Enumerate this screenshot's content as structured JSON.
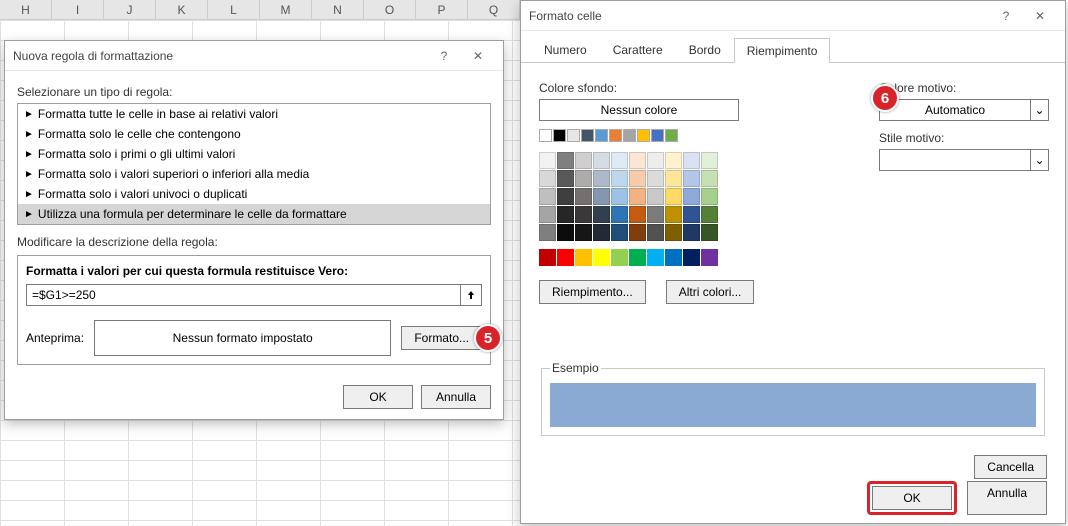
{
  "sheet": {
    "columns": [
      "H",
      "I",
      "J",
      "K",
      "L",
      "M",
      "N",
      "O",
      "P",
      "Q"
    ]
  },
  "dlg1": {
    "title": "Nuova regola di formattazione",
    "select_label": "Selezionare un tipo di regola:",
    "rules": [
      "Formatta tutte le celle in base ai relativi valori",
      "Formatta solo le celle che contengono",
      "Formatta solo i primi o gli ultimi valori",
      "Formatta solo i valori superiori o inferiori alla media",
      "Formatta solo i valori univoci o duplicati",
      "Utilizza una formula per determinare le celle da formattare"
    ],
    "selected_rule_index": 5,
    "edit_label": "Modificare la descrizione della regola:",
    "formula_header": "Formatta i valori per cui questa formula restituisce Vero:",
    "formula_value": "=$G1>=250",
    "preview_label": "Anteprima:",
    "preview_value": "Nessun formato impostato",
    "format_btn": "Formato...",
    "ok": "OK",
    "cancel": "Annulla"
  },
  "dlg2": {
    "title": "Formato celle",
    "tabs": [
      "Numero",
      "Carattere",
      "Bordo",
      "Riempimento"
    ],
    "active_tab_index": 3,
    "bg_label": "Colore sfondo:",
    "bg_value": "Nessun colore",
    "pattern_color_label": "Colore motivo:",
    "pattern_color_value": "Automatico",
    "pattern_style_label": "Stile motivo:",
    "pattern_style_value": "",
    "fill_effects_btn": "Riempimento...",
    "more_colors_btn": "Altri colori...",
    "example_label": "Esempio",
    "example_color": "#8aaad4",
    "clear_btn": "Cancella",
    "ok": "OK",
    "cancel": "Annulla",
    "simple_swatches": [
      "#ffffff",
      "#000000",
      "#e7e6e6",
      "#44546a",
      "#5b9bd5",
      "#ed7d31",
      "#a5a5a5",
      "#ffc000",
      "#4472c4",
      "#70ad47"
    ],
    "theme_swatches": [
      "#f2f2f2",
      "#7f7f7f",
      "#d0cece",
      "#d6dce4",
      "#deebf6",
      "#fbe5d5",
      "#ededed",
      "#fff2cc",
      "#d9e2f3",
      "#e2efd9",
      "#d8d8d8",
      "#595959",
      "#aeabab",
      "#adb9ca",
      "#bdd7ee",
      "#f7cbac",
      "#dbdbdb",
      "#fee599",
      "#b4c6e7",
      "#c5e0b3",
      "#bfbfbf",
      "#3f3f3f",
      "#757070",
      "#8496b0",
      "#9cc3e5",
      "#f4b183",
      "#c9c9c9",
      "#ffd965",
      "#8eaadb",
      "#a8d08d",
      "#a5a5a5",
      "#262626",
      "#3a3838",
      "#323f4f",
      "#2e75b5",
      "#c55a11",
      "#7b7b7b",
      "#bf9000",
      "#2f5496",
      "#538135",
      "#7f7f7f",
      "#0c0c0c",
      "#171616",
      "#222a35",
      "#1e4e79",
      "#833c0b",
      "#525252",
      "#7f6000",
      "#1f3864",
      "#375623"
    ],
    "standard_swatches": [
      "#c00000",
      "#ff0000",
      "#ffc000",
      "#ffff00",
      "#92d050",
      "#00b050",
      "#00b0f0",
      "#0070c0",
      "#002060",
      "#7030a0"
    ]
  },
  "badges": {
    "b1": "5",
    "b2": "6"
  }
}
